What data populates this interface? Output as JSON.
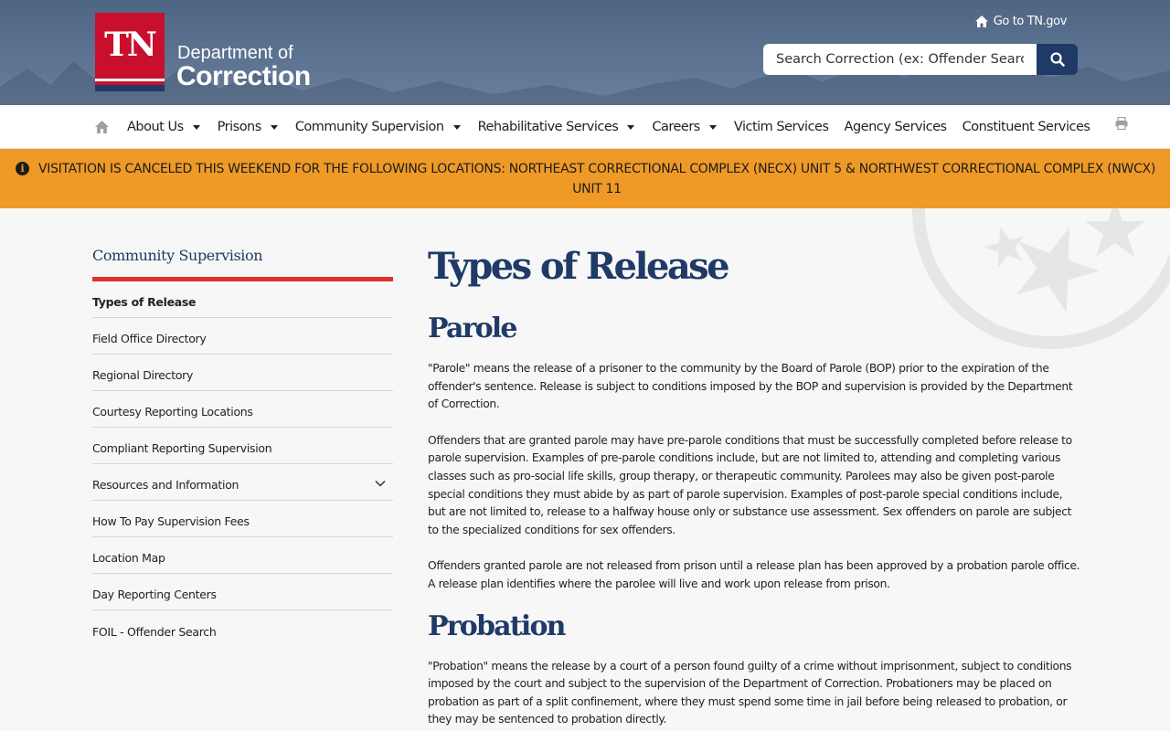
{
  "header": {
    "logo": {
      "badge": "TN",
      "line1": "Department of",
      "line2": "Correction"
    },
    "goto_label": "Go to TN.gov",
    "search": {
      "placeholder": "Search Correction (ex: Offender Search)"
    }
  },
  "nav": {
    "items": [
      {
        "label": "About Us",
        "dropdown": true
      },
      {
        "label": "Prisons",
        "dropdown": true
      },
      {
        "label": "Community Supervision",
        "dropdown": true
      },
      {
        "label": "Rehabilitative Services",
        "dropdown": true
      },
      {
        "label": "Careers",
        "dropdown": true
      },
      {
        "label": "Victim Services",
        "dropdown": false
      },
      {
        "label": "Agency Services",
        "dropdown": false
      },
      {
        "label": "Constituent Services",
        "dropdown": false
      }
    ]
  },
  "alert": {
    "text": "VISITATION IS CANCELED THIS WEEKEND FOR THE FOLLOWING LOCATIONS: NORTHEAST CORRECTIONAL COMPLEX (NECX) UNIT 5 & NORTHWEST CORRECTIONAL COMPLEX (NWCX) UNIT 11"
  },
  "sidebar": {
    "title": "Community Supervision",
    "items": [
      {
        "label": "Types of Release",
        "active": true
      },
      {
        "label": "Field Office Directory"
      },
      {
        "label": "Regional Directory"
      },
      {
        "label": "Courtesy Reporting Locations"
      },
      {
        "label": "Compliant Reporting Supervision"
      },
      {
        "label": "Resources and Information",
        "expandable": true
      },
      {
        "label": "How To Pay Supervision Fees"
      },
      {
        "label": "Location Map"
      },
      {
        "label": "Day Reporting Centers"
      },
      {
        "label": "FOIL - Offender Search"
      }
    ]
  },
  "main": {
    "title": "Types of Release",
    "sections": [
      {
        "heading": "Parole",
        "paragraphs": [
          "\"Parole\" means the release of a prisoner to the community by the Board of Parole (BOP) prior to the expiration of the offender's sentence. Release is subject to conditions imposed by the BOP and supervision is provided by the Department of Correction.",
          "Offenders that are granted parole may have pre-parole conditions that must be successfully completed before release to parole supervision. Examples of pre-parole conditions include, but are not limited to, attending and completing various classes such as pro-social life skills, group therapy, or therapeutic community. Parolees may also be given post-parole special conditions they must abide by as part of parole supervision. Examples of post-parole special conditions include, but are not limited to, release to a halfway house only or substance use assessment. Sex offenders on parole are subject to the specialized conditions for sex offenders.",
          "Offenders granted parole are not released from prison until a release plan has been approved by a probation parole office. A release plan identifies where the parolee will live and work upon release from prison."
        ]
      },
      {
        "heading": "Probation",
        "paragraphs": [
          "\"Probation\" means the release by a court of a person found guilty of a crime without imprisonment, subject to conditions imposed by the court and subject to the supervision of the Department of Correction. Probationers may be placed on probation as part of a split confinement, where they must spend some time in jail before being released to probation, or they may be sentenced to probation directly."
        ]
      }
    ]
  },
  "colors": {
    "navy": "#1f3a66",
    "alert_bg": "#ef9a27",
    "accent_red": "#e0312b",
    "header_bg": "#566c8b"
  },
  "icons": [
    "home-icon",
    "search-icon",
    "print-icon",
    "info-icon",
    "chevron-down-icon",
    "caret-down-icon"
  ]
}
